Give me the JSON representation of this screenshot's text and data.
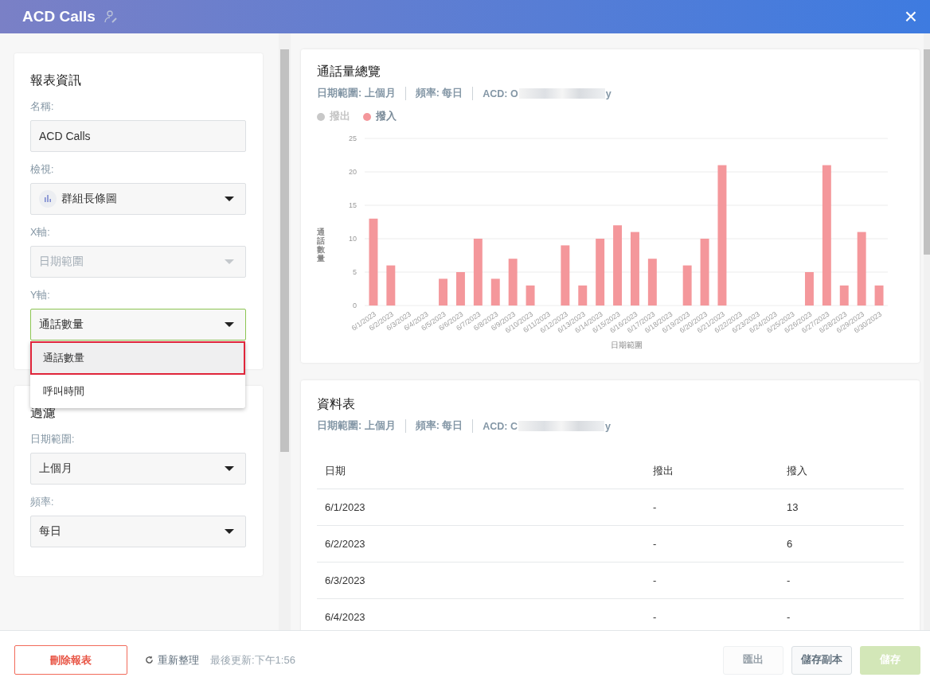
{
  "header": {
    "title": "ACD Calls",
    "close": "×"
  },
  "report_info": {
    "title": "報表資訊",
    "fields": [
      {
        "label": "名稱:",
        "kind": "text",
        "value": "ACD Calls"
      },
      {
        "label": "檢視:",
        "kind": "chart-select",
        "value": "群組長條圖",
        "disabled": false,
        "open": false
      },
      {
        "label": "X軸:",
        "kind": "select",
        "value": "日期範圍",
        "disabled": true,
        "open": false
      },
      {
        "label": "Y軸:",
        "kind": "select",
        "value": "通話數量",
        "disabled": false,
        "open": true,
        "options": [
          {
            "label": "通話數量",
            "selected": true
          },
          {
            "label": "呼叫時間",
            "selected": false
          }
        ]
      }
    ]
  },
  "filters": {
    "title": "過濾",
    "fields": [
      {
        "label": "日期範圍:",
        "kind": "select",
        "value": "上個月",
        "disabled": false,
        "open": false
      },
      {
        "label": "頻率:",
        "kind": "select",
        "value": "每日",
        "disabled": false,
        "open": false
      }
    ]
  },
  "chart_card": {
    "title": "通話量總覽",
    "meta": [
      {
        "text": "日期範圍: 上個月"
      },
      {
        "text": "頻率: 每日"
      },
      {
        "text": "ACD: O",
        "redacted": true,
        "tail": "y"
      }
    ],
    "legend": [
      {
        "name": "撥出",
        "color": "#c8c8c8",
        "hidden": true
      }
    ],
    "chart_data": {
      "type": "bar",
      "grid": true,
      "xlabel": "日期範圍",
      "ylabel": "通話數量",
      "ylim": [
        0,
        25
      ],
      "yticks": [
        0,
        5,
        10,
        15,
        20,
        25
      ],
      "categories": [
        "6/1/2023",
        "6/2/2023",
        "6/3/2023",
        "6/4/2023",
        "6/5/2023",
        "6/6/2023",
        "6/7/2023",
        "6/8/2023",
        "6/9/2023",
        "6/10/2023",
        "6/11/2023",
        "6/12/2023",
        "6/13/2023",
        "6/14/2023",
        "6/15/2023",
        "6/16/2023",
        "6/17/2023",
        "6/18/2023",
        "6/19/2023",
        "6/20/2023",
        "6/21/2023",
        "6/22/2023",
        "6/23/2023",
        "6/24/2023",
        "6/25/2023",
        "6/26/2023",
        "6/27/2023",
        "6/28/2023",
        "6/29/2023",
        "6/30/2023"
      ],
      "series": [
        {
          "name": "撥入",
          "color": "#f4979b",
          "values": [
            13,
            6,
            null,
            null,
            4,
            5,
            10,
            4,
            7,
            3,
            null,
            9,
            3,
            10,
            12,
            11,
            7,
            null,
            6,
            10,
            21,
            null,
            null,
            null,
            null,
            5,
            21,
            3,
            11,
            3
          ]
        }
      ]
    }
  },
  "table_card": {
    "title": "資料表",
    "meta": [
      {
        "text": "日期範圍: 上個月"
      },
      {
        "text": "頻率: 每日"
      },
      {
        "text": "ACD: C",
        "redacted": true,
        "tail": "y"
      }
    ],
    "columns": [
      "日期",
      "撥出",
      "撥入"
    ],
    "rows": [
      [
        "6/1/2023",
        "-",
        "13"
      ],
      [
        "6/2/2023",
        "-",
        "6"
      ],
      [
        "6/3/2023",
        "-",
        "-"
      ],
      [
        "6/4/2023",
        "-",
        "-"
      ]
    ]
  },
  "footer": {
    "delete_button": "刪除報表",
    "refresh": "重新整理",
    "last_updated": "最後更新:下午1:56",
    "buttons": [
      {
        "label": "匯出",
        "kind": "secondary",
        "disabled": true
      },
      {
        "label": "儲存副本",
        "kind": "secondary",
        "disabled": false
      },
      {
        "label": "儲存",
        "kind": "primary",
        "disabled": true
      }
    ]
  }
}
